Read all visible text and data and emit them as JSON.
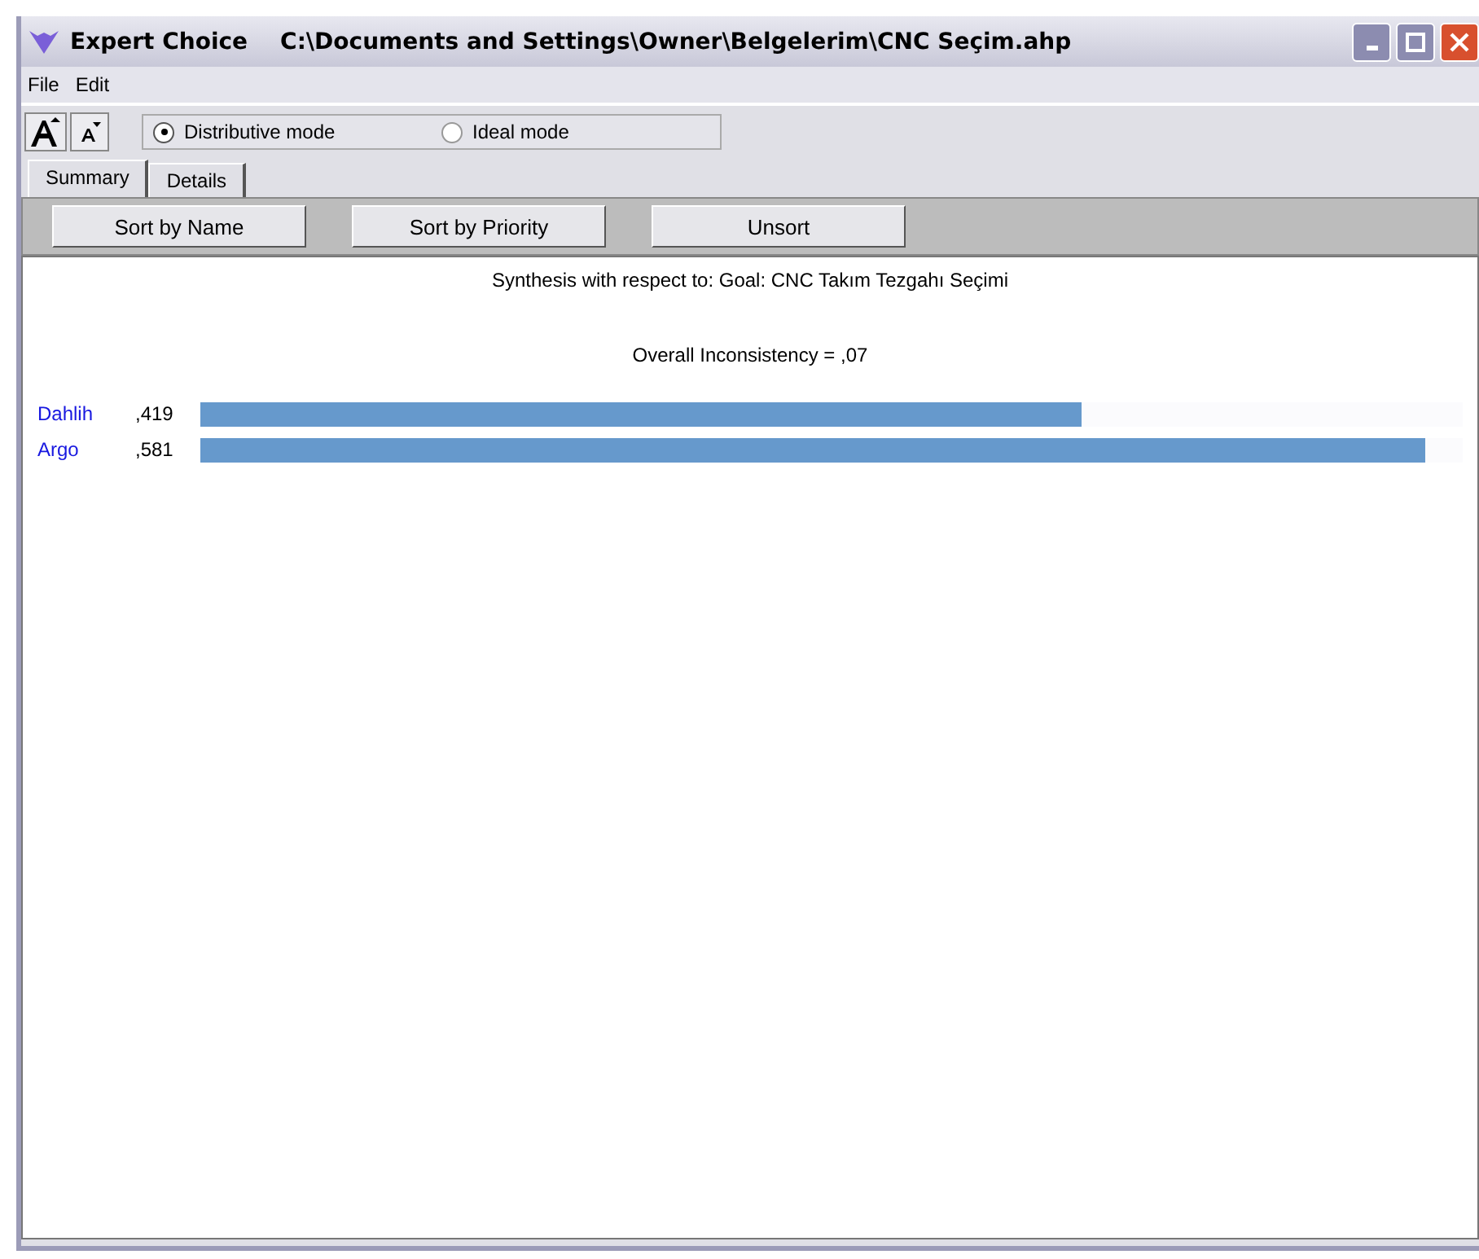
{
  "window": {
    "app_name": "Expert Choice",
    "title": "C:\\Documents and Settings\\Owner\\Belgelerim\\CNC Seçim.ahp"
  },
  "menu": [
    "File",
    "Edit"
  ],
  "modes": [
    {
      "label": "Distributive mode",
      "selected": true
    },
    {
      "label": "Ideal mode",
      "selected": false
    }
  ],
  "tabs": [
    {
      "label": "Summary",
      "selected": true
    },
    {
      "label": "Details",
      "selected": false
    }
  ],
  "buttons": [
    "Sort by Name",
    "Sort by Priority",
    "Unsort"
  ],
  "synthesis_title": "Synthesis with respect to: Goal: CNC Takım Tezgahı Seçimi",
  "inconsistency": "Overall Inconsistency = ,07",
  "alternatives": [
    {
      "name": "Dahlih",
      "priority": ",419",
      "level": 0.698
    },
    {
      "name": "Argo",
      "priority": ",581",
      "level": 0.97
    }
  ]
}
